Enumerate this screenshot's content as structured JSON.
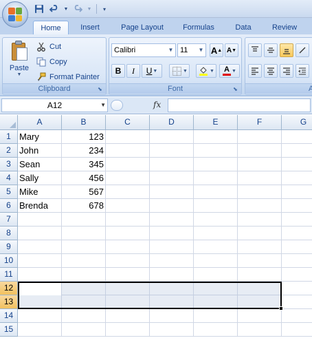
{
  "quick_access": {
    "icons": [
      "office-button-icon",
      "save-icon",
      "undo-icon",
      "redo-icon",
      "customize-icon"
    ]
  },
  "tabs": [
    {
      "label": "Home",
      "active": true
    },
    {
      "label": "Insert"
    },
    {
      "label": "Page Layout"
    },
    {
      "label": "Formulas"
    },
    {
      "label": "Data"
    },
    {
      "label": "Review"
    }
  ],
  "clipboard": {
    "paste": "Paste",
    "cut": "Cut",
    "copy": "Copy",
    "format_painter": "Format Painter",
    "group_label": "Clipboard"
  },
  "font": {
    "family": "Calibri",
    "size": "11",
    "bold": "B",
    "italic": "I",
    "underline": "U",
    "font_color_glyph": "A",
    "grow_glyph": "A",
    "shrink_glyph": "A",
    "group_label": "Font"
  },
  "alignment": {
    "group_label": "A"
  },
  "formula_bar": {
    "name_box": "A12",
    "fx": "fx",
    "value": ""
  },
  "columns": [
    "A",
    "B",
    "C",
    "D",
    "E",
    "F",
    "G"
  ],
  "rows": [
    "1",
    "2",
    "3",
    "4",
    "5",
    "6",
    "7",
    "8",
    "9",
    "10",
    "11",
    "12",
    "13",
    "14",
    "15"
  ],
  "sheet": {
    "cells": [
      {
        "name": "Mary",
        "value": "123"
      },
      {
        "name": "John",
        "value": "234"
      },
      {
        "name": "Sean",
        "value": "345"
      },
      {
        "name": "Sally",
        "value": "456"
      },
      {
        "name": "Mike",
        "value": "567"
      },
      {
        "name": "Brenda",
        "value": "678"
      }
    ],
    "selection": "A12:F13"
  },
  "colors": {
    "ribbon_blue": "#d3e2f4",
    "header_selected": "#f1c15f",
    "selection_fill": "#aab9d7"
  }
}
